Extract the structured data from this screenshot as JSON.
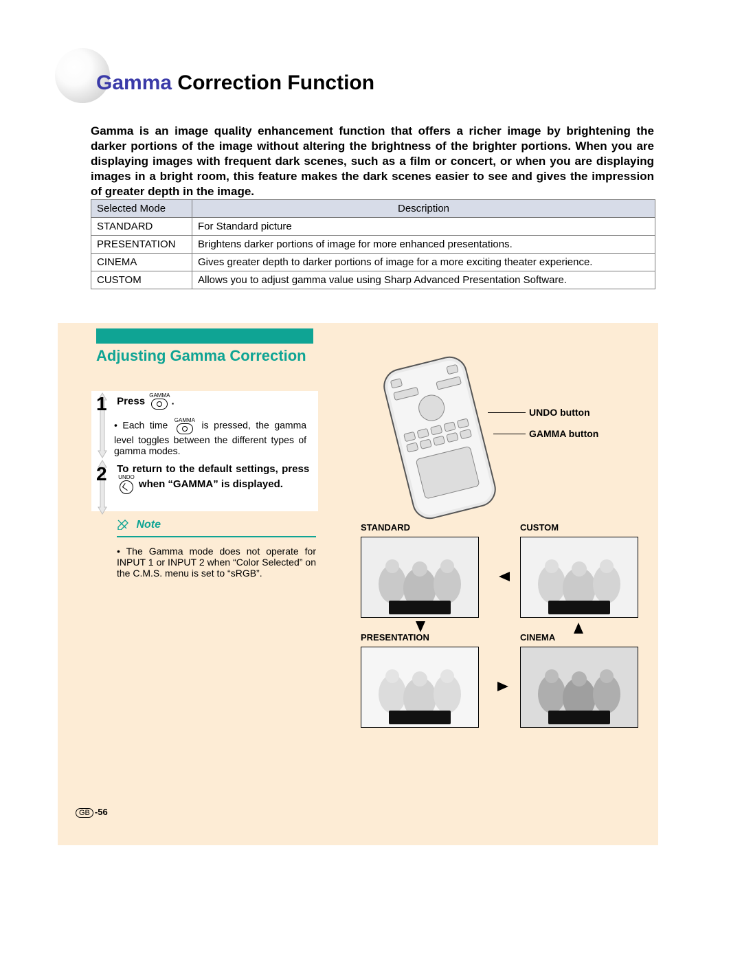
{
  "title": {
    "accent": "Gamma",
    "rest": " Correction Function"
  },
  "intro": "Gamma is an image quality enhancement function that offers a richer image by brightening the darker portions of the image without altering the brightness of the brighter portions. When you are displaying images with frequent dark scenes, such as a film or concert, or when you are displaying images in a bright room, this feature makes the dark scenes easier to see and gives the impression of greater depth in the image.",
  "table": {
    "head": {
      "c1": "Selected Mode",
      "c2": "Description"
    },
    "rows": [
      {
        "mode": "STANDARD",
        "desc": "For Standard picture"
      },
      {
        "mode": "PRESENTATION",
        "desc": "Brightens darker portions of image for more enhanced presentations."
      },
      {
        "mode": "CINEMA",
        "desc": "Gives greater depth to darker portions of image for a more exciting theater experience."
      },
      {
        "mode": "CUSTOM",
        "desc": "Allows you to adjust gamma value using Sharp Advanced Presentation Software."
      }
    ]
  },
  "subheading": "Adjusting Gamma Correction",
  "step1": {
    "lead": "Press ",
    "button_label": "GAMMA",
    "tail": ".",
    "bullet_a": "Each time ",
    "bullet_b": " is pressed, the gamma level toggles between the different types of gamma modes."
  },
  "step2": {
    "a": "To return to the default settings, press ",
    "undo_label": "UNDO",
    "b": " when “GAMMA” is displayed."
  },
  "note": {
    "label": "Note",
    "body": "The Gamma mode does not operate for INPUT 1 or INPUT 2 when “Color Selected” on the C.M.S. menu is set to “sRGB”."
  },
  "callouts": {
    "undo": "UNDO button",
    "gamma": "GAMMA button"
  },
  "thumbs": {
    "a": "STANDARD",
    "b": "CUSTOM",
    "c": "PRESENTATION",
    "d": "CINEMA"
  },
  "page_num": "-56",
  "gb": "GB"
}
